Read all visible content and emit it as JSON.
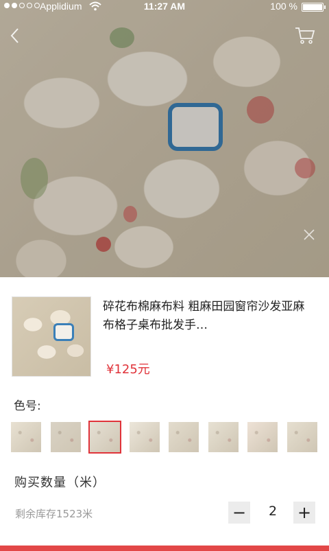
{
  "status_bar": {
    "carrier": "Applidium",
    "time": "11:27 AM",
    "battery": "100 %"
  },
  "icons": {
    "back": "back-chevron-icon",
    "cart": "shopping-cart-icon",
    "close": "close-icon",
    "wifi": "wifi-icon",
    "battery": "battery-icon",
    "signal": "signal-dots-icon"
  },
  "product": {
    "title": "碎花布棉麻布料 粗麻田园窗帘沙发亚麻布格子桌布批发手…",
    "price": "¥125元"
  },
  "colors": {
    "label": "色号:",
    "selected_index": 2,
    "swatches": [
      {
        "name": "swatch-1",
        "base": "#e8e1d2"
      },
      {
        "name": "swatch-2",
        "base": "#d9d2c4"
      },
      {
        "name": "swatch-3",
        "base": "#e6e0d4"
      },
      {
        "name": "swatch-4",
        "base": "#ece6da"
      },
      {
        "name": "swatch-5",
        "base": "#e3dccd"
      },
      {
        "name": "swatch-6",
        "base": "#e7e1d3"
      },
      {
        "name": "swatch-7",
        "base": "#eee2d6"
      },
      {
        "name": "swatch-8",
        "base": "#e6dfd0"
      }
    ]
  },
  "quantity": {
    "label": "购买数量（米）",
    "stock": "剩余库存1523米",
    "minus": "−",
    "value": "2",
    "plus": "+"
  },
  "theme": {
    "accent": "#e0333a",
    "bottom_bar": "#e24747"
  }
}
